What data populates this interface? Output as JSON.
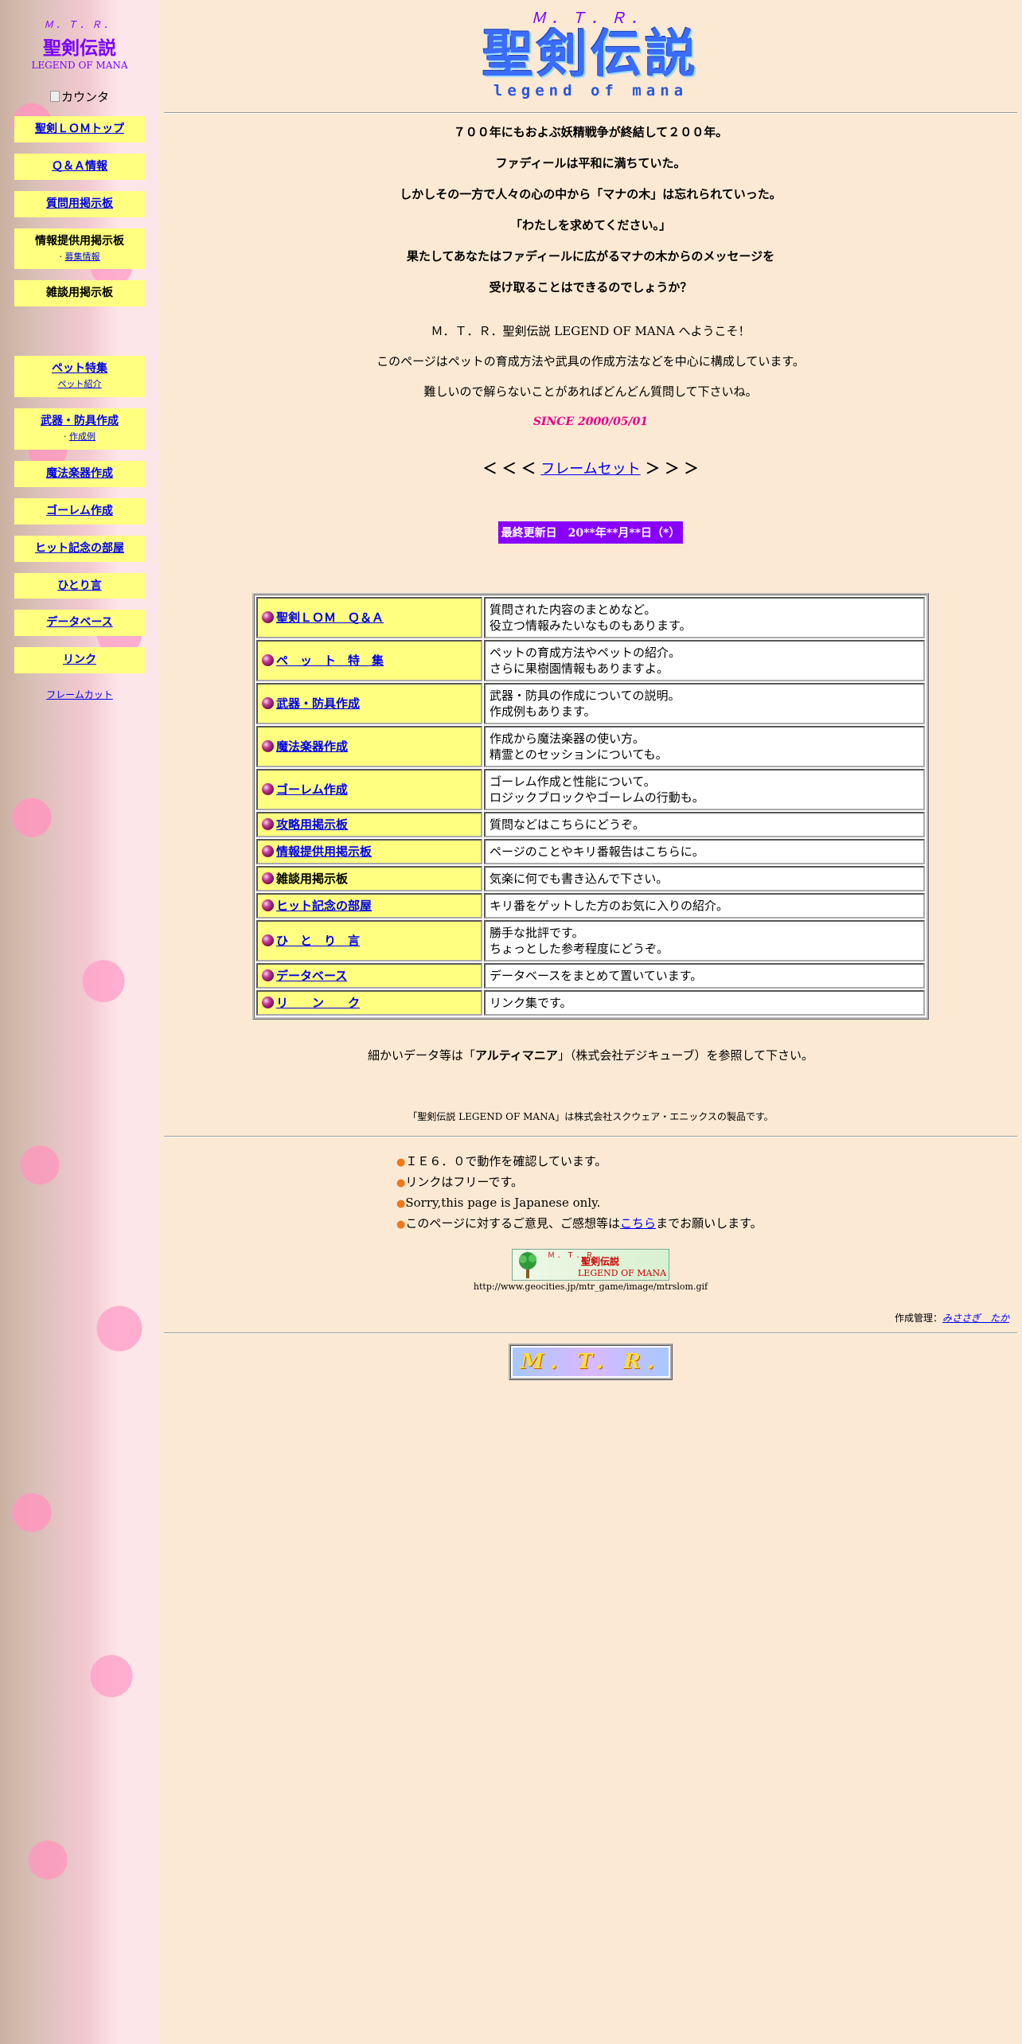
{
  "sidebar": {
    "mtr": "Ｍ．Ｔ．Ｒ．",
    "title": "聖剣伝説",
    "subtitle": "LEGEND OF MANA",
    "counter_alt": "カウンタ",
    "items": [
      {
        "label": "聖剣ＬＯＭトップ"
      },
      {
        "label": "Ｑ＆Ａ情報"
      },
      {
        "label": "質問用掲示板"
      },
      {
        "label": "情報提供用掲示板",
        "sub": "募集情報"
      },
      {
        "label": "雑談用掲示板"
      },
      {
        "label": "ペット特集",
        "sub": "ペット紹介"
      },
      {
        "label": "武器・防具作成",
        "sub": "作成例"
      },
      {
        "label": "魔法楽器作成"
      },
      {
        "label": "ゴーレム作成"
      },
      {
        "label": "ヒット記念の部屋"
      },
      {
        "label": "ひとり言"
      },
      {
        "label": "データベース"
      },
      {
        "label": "リンク"
      }
    ],
    "framecut": "フレームカット"
  },
  "header": {
    "mtr": "Ｍ．Ｔ．Ｒ．",
    "kanji": "聖剣伝説",
    "english": "legend of mana"
  },
  "intro": [
    "７００年にもおよぶ妖精戦争が終結して２００年。",
    "ファディールは平和に満ちていた。",
    "しかしその一方で人々の心の中から「マナの木」は忘れられていった。",
    "「わたしを求めてください。」",
    "果たしてあなたはファディールに広がるマナの木からのメッセージを",
    "受け取ることはできるのでしょうか？"
  ],
  "welcome": [
    "Ｍ．Ｔ．Ｒ．聖剣伝説 LEGEND OF MANA へようこそ！",
    "このページはペットの育成方法や武具の作成方法などを中心に構成しています。",
    "難しいので解らないことがあればどんどん質問して下さいね。"
  ],
  "since": "SINCE 2000/05/01",
  "frameset": {
    "left": "＜ ＜ ＜ ",
    "link": "フレームセット",
    "right": " ＞ ＞ ＞"
  },
  "last_updated": "最終更新日　20**年**月**日（*）",
  "index_table": [
    {
      "name": "聖剣ＬＯＭ　Ｑ＆Ａ",
      "link": true,
      "desc1": "質問された内容のまとめなど。",
      "desc2": "役立つ情報みたいなものもあります。"
    },
    {
      "name": "ペ　ッ　ト　特　集",
      "link": true,
      "desc1": "ペットの育成方法やペットの紹介。",
      "desc2": "さらに果樹園情報もありますよ。"
    },
    {
      "name": "武器・防具作成",
      "link": true,
      "desc1": "武器・防具の作成についての説明。",
      "desc2": "作成例もあります。"
    },
    {
      "name": "魔法楽器作成",
      "link": true,
      "desc1": "作成から魔法楽器の使い方。",
      "desc2": "精霊とのセッションについても。"
    },
    {
      "name": "ゴーレム作成",
      "link": true,
      "desc1": "ゴーレム作成と性能について。",
      "desc2": "ロジックブロックやゴーレムの行動も。"
    },
    {
      "name": "攻略用掲示板",
      "link": true,
      "desc1": "質問などはこちらにどうぞ。",
      "desc2": ""
    },
    {
      "name": "情報提供用掲示板",
      "link": true,
      "desc1": "ページのことやキリ番報告はこちらに。",
      "desc2": ""
    },
    {
      "name": "雑談用掲示板",
      "link": false,
      "desc1": "気楽に何でも書き込んで下さい。",
      "desc2": ""
    },
    {
      "name": "ヒット記念の部屋",
      "link": true,
      "desc1": "キリ番をゲットした方のお気に入りの紹介。",
      "desc2": ""
    },
    {
      "name": "ひ　と　り　言",
      "link": true,
      "desc1": "勝手な批評です。",
      "desc2": "ちょっとした参考程度にどうぞ。"
    },
    {
      "name": "データベース",
      "link": true,
      "desc1": "データベースをまとめて置いています。",
      "desc2": ""
    },
    {
      "name": "リ　　ン　　ク",
      "link": true,
      "desc1": "リンク集です。",
      "desc2": ""
    }
  ],
  "reference": {
    "pre": "細かいデータ等は「",
    "bold": "アルティマニア",
    "post": "」（株式会社デジキューブ）を参照して下さい。"
  },
  "copyright": "「聖剣伝説 LEGEND OF MANA」は株式会社スクウェア・エニックスの製品です。",
  "notes": {
    "bullet": "●",
    "n1": "ＩＥ６．０で動作を確認しています。",
    "n2": "リンクはフリーです。",
    "n3": "Sorry,this page is Japanese only.",
    "n4_pre": "このページに対するご意見、ご感想等は",
    "n4_link": "こちら",
    "n4_post": "までお願いします。"
  },
  "banner": {
    "t1": "Ｍ．Ｔ．Ｒ．",
    "t2": "聖剣伝説",
    "t3": "LEGEND OF MANA",
    "url": "http://www.geocities.jp/mtr_game/image/mtrslom.gif"
  },
  "author": {
    "label": "作成管理：",
    "name": "みささぎ　たか"
  },
  "footer_logo": "M. T. R."
}
